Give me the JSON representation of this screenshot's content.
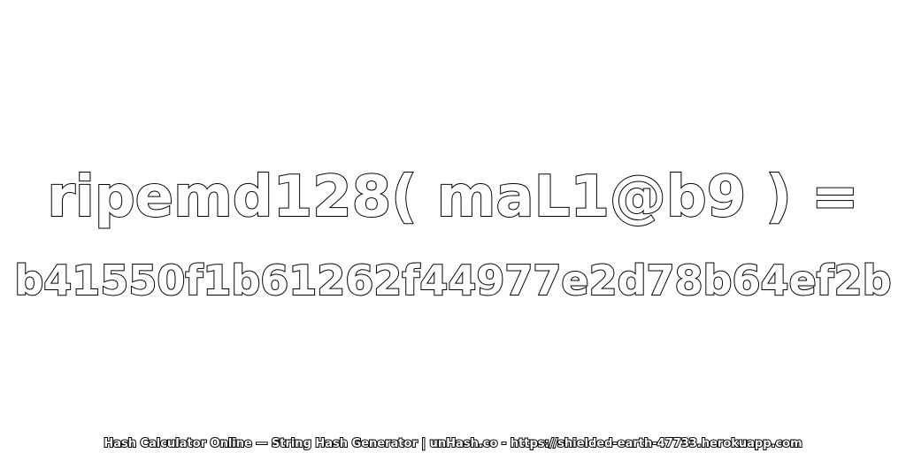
{
  "expression": "ripemd128( maL1@b9 ) =",
  "hash": "b41550f1b61262f44977e2d78b64ef2b",
  "footer": "Hash Calculator Online — String Hash Generator | unHash.co - https://shielded-earth-47733.herokuapp.com",
  "colors": {
    "background": "#ffffff",
    "text_fill": "#ffffff",
    "text_stroke": "#000000"
  }
}
